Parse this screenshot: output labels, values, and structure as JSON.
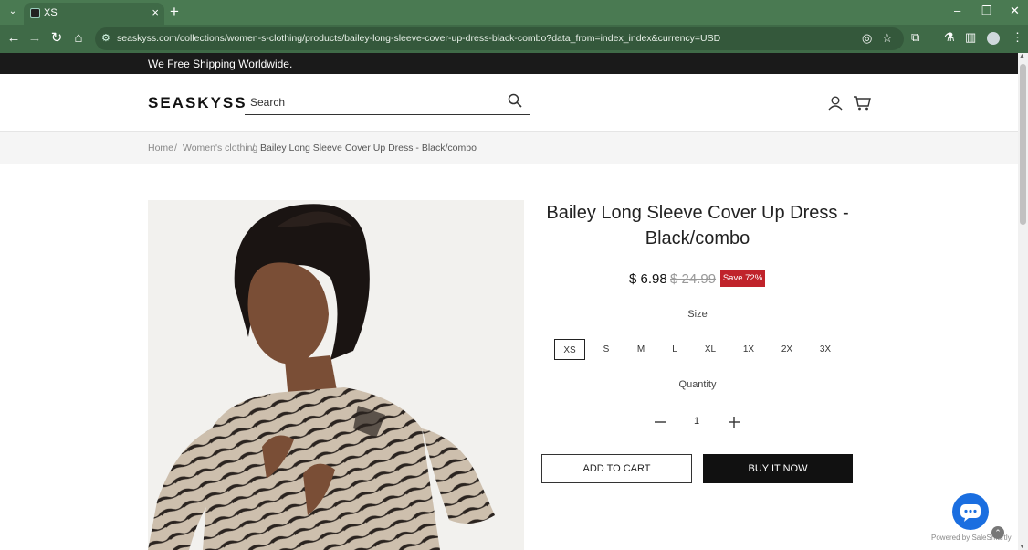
{
  "browser": {
    "tab_title": "XS",
    "url": "seaskyss.com/collections/women-s-clothing/products/bailey-long-sleeve-cover-up-dress-black-combo?data_from=index_index&currency=USD",
    "accent": "#4a7a52"
  },
  "announcement": "We Free Shipping Worldwide.",
  "header": {
    "logo": "SEASKYSS",
    "search_placeholder": "Search"
  },
  "breadcrumb": {
    "home": "Home",
    "category": "Women's clothing",
    "separator": "/",
    "current": "Bailey Long Sleeve Cover Up Dress - Black/combo"
  },
  "product": {
    "title": "Bailey Long Sleeve Cover Up Dress - Black/combo",
    "price": "$ 6.98",
    "compare_price": "$ 24.99",
    "save_badge": "Save 72%",
    "size_label": "Size",
    "sizes": [
      "XS",
      "S",
      "M",
      "L",
      "XL",
      "1X",
      "2X",
      "3X"
    ],
    "selected_size": "XS",
    "quantity_label": "Quantity",
    "quantity": "1",
    "add_to_cart": "ADD TO CART",
    "buy_now": "BUY IT NOW"
  },
  "widget": {
    "powered_by": "Powered by SaleSmartly",
    "chat_color": "#1a6ee0"
  }
}
